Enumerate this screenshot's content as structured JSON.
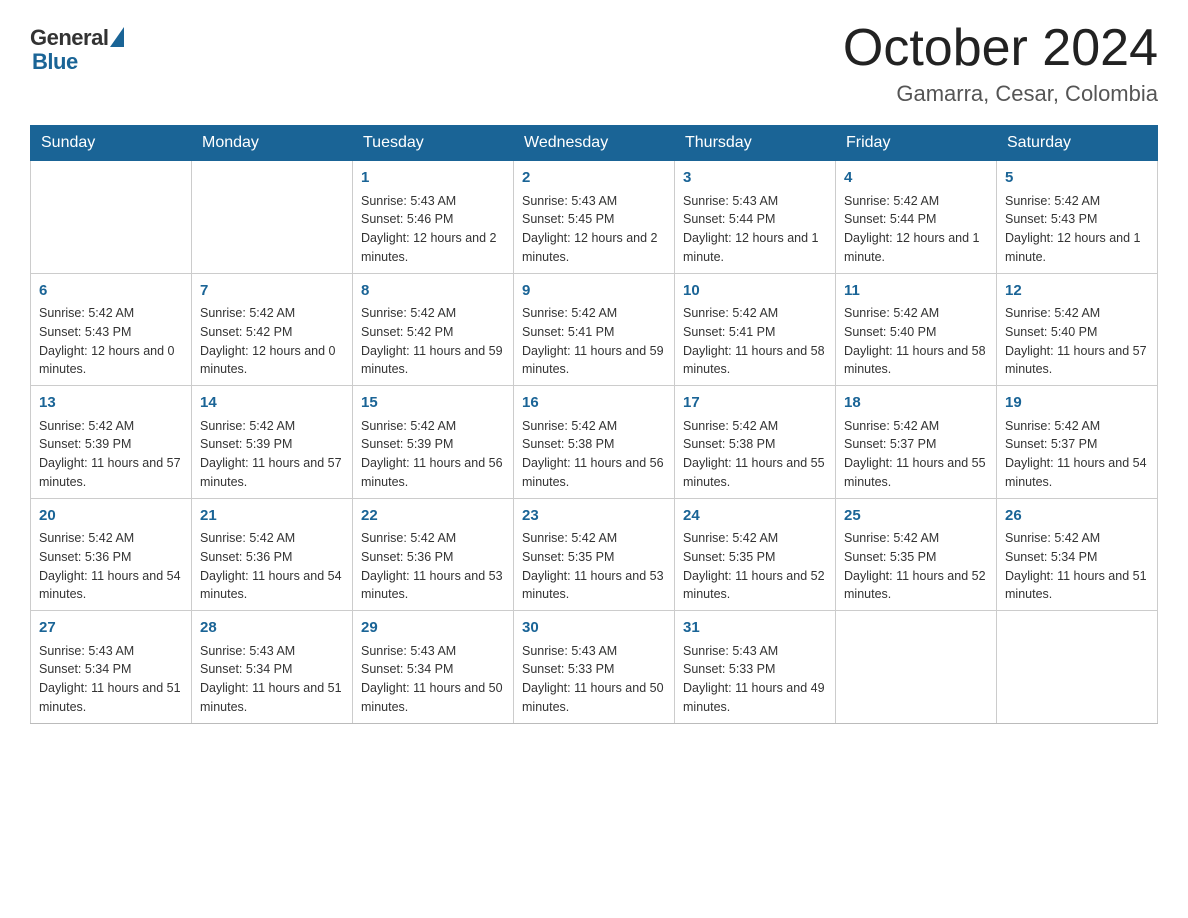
{
  "logo": {
    "general": "General",
    "blue": "Blue"
  },
  "header": {
    "month": "October 2024",
    "location": "Gamarra, Cesar, Colombia"
  },
  "weekdays": [
    "Sunday",
    "Monday",
    "Tuesday",
    "Wednesday",
    "Thursday",
    "Friday",
    "Saturday"
  ],
  "weeks": [
    [
      {
        "day": "",
        "sunrise": "",
        "sunset": "",
        "daylight": ""
      },
      {
        "day": "",
        "sunrise": "",
        "sunset": "",
        "daylight": ""
      },
      {
        "day": "1",
        "sunrise": "Sunrise: 5:43 AM",
        "sunset": "Sunset: 5:46 PM",
        "daylight": "Daylight: 12 hours and 2 minutes."
      },
      {
        "day": "2",
        "sunrise": "Sunrise: 5:43 AM",
        "sunset": "Sunset: 5:45 PM",
        "daylight": "Daylight: 12 hours and 2 minutes."
      },
      {
        "day": "3",
        "sunrise": "Sunrise: 5:43 AM",
        "sunset": "Sunset: 5:44 PM",
        "daylight": "Daylight: 12 hours and 1 minute."
      },
      {
        "day": "4",
        "sunrise": "Sunrise: 5:42 AM",
        "sunset": "Sunset: 5:44 PM",
        "daylight": "Daylight: 12 hours and 1 minute."
      },
      {
        "day": "5",
        "sunrise": "Sunrise: 5:42 AM",
        "sunset": "Sunset: 5:43 PM",
        "daylight": "Daylight: 12 hours and 1 minute."
      }
    ],
    [
      {
        "day": "6",
        "sunrise": "Sunrise: 5:42 AM",
        "sunset": "Sunset: 5:43 PM",
        "daylight": "Daylight: 12 hours and 0 minutes."
      },
      {
        "day": "7",
        "sunrise": "Sunrise: 5:42 AM",
        "sunset": "Sunset: 5:42 PM",
        "daylight": "Daylight: 12 hours and 0 minutes."
      },
      {
        "day": "8",
        "sunrise": "Sunrise: 5:42 AM",
        "sunset": "Sunset: 5:42 PM",
        "daylight": "Daylight: 11 hours and 59 minutes."
      },
      {
        "day": "9",
        "sunrise": "Sunrise: 5:42 AM",
        "sunset": "Sunset: 5:41 PM",
        "daylight": "Daylight: 11 hours and 59 minutes."
      },
      {
        "day": "10",
        "sunrise": "Sunrise: 5:42 AM",
        "sunset": "Sunset: 5:41 PM",
        "daylight": "Daylight: 11 hours and 58 minutes."
      },
      {
        "day": "11",
        "sunrise": "Sunrise: 5:42 AM",
        "sunset": "Sunset: 5:40 PM",
        "daylight": "Daylight: 11 hours and 58 minutes."
      },
      {
        "day": "12",
        "sunrise": "Sunrise: 5:42 AM",
        "sunset": "Sunset: 5:40 PM",
        "daylight": "Daylight: 11 hours and 57 minutes."
      }
    ],
    [
      {
        "day": "13",
        "sunrise": "Sunrise: 5:42 AM",
        "sunset": "Sunset: 5:39 PM",
        "daylight": "Daylight: 11 hours and 57 minutes."
      },
      {
        "day": "14",
        "sunrise": "Sunrise: 5:42 AM",
        "sunset": "Sunset: 5:39 PM",
        "daylight": "Daylight: 11 hours and 57 minutes."
      },
      {
        "day": "15",
        "sunrise": "Sunrise: 5:42 AM",
        "sunset": "Sunset: 5:39 PM",
        "daylight": "Daylight: 11 hours and 56 minutes."
      },
      {
        "day": "16",
        "sunrise": "Sunrise: 5:42 AM",
        "sunset": "Sunset: 5:38 PM",
        "daylight": "Daylight: 11 hours and 56 minutes."
      },
      {
        "day": "17",
        "sunrise": "Sunrise: 5:42 AM",
        "sunset": "Sunset: 5:38 PM",
        "daylight": "Daylight: 11 hours and 55 minutes."
      },
      {
        "day": "18",
        "sunrise": "Sunrise: 5:42 AM",
        "sunset": "Sunset: 5:37 PM",
        "daylight": "Daylight: 11 hours and 55 minutes."
      },
      {
        "day": "19",
        "sunrise": "Sunrise: 5:42 AM",
        "sunset": "Sunset: 5:37 PM",
        "daylight": "Daylight: 11 hours and 54 minutes."
      }
    ],
    [
      {
        "day": "20",
        "sunrise": "Sunrise: 5:42 AM",
        "sunset": "Sunset: 5:36 PM",
        "daylight": "Daylight: 11 hours and 54 minutes."
      },
      {
        "day": "21",
        "sunrise": "Sunrise: 5:42 AM",
        "sunset": "Sunset: 5:36 PM",
        "daylight": "Daylight: 11 hours and 54 minutes."
      },
      {
        "day": "22",
        "sunrise": "Sunrise: 5:42 AM",
        "sunset": "Sunset: 5:36 PM",
        "daylight": "Daylight: 11 hours and 53 minutes."
      },
      {
        "day": "23",
        "sunrise": "Sunrise: 5:42 AM",
        "sunset": "Sunset: 5:35 PM",
        "daylight": "Daylight: 11 hours and 53 minutes."
      },
      {
        "day": "24",
        "sunrise": "Sunrise: 5:42 AM",
        "sunset": "Sunset: 5:35 PM",
        "daylight": "Daylight: 11 hours and 52 minutes."
      },
      {
        "day": "25",
        "sunrise": "Sunrise: 5:42 AM",
        "sunset": "Sunset: 5:35 PM",
        "daylight": "Daylight: 11 hours and 52 minutes."
      },
      {
        "day": "26",
        "sunrise": "Sunrise: 5:42 AM",
        "sunset": "Sunset: 5:34 PM",
        "daylight": "Daylight: 11 hours and 51 minutes."
      }
    ],
    [
      {
        "day": "27",
        "sunrise": "Sunrise: 5:43 AM",
        "sunset": "Sunset: 5:34 PM",
        "daylight": "Daylight: 11 hours and 51 minutes."
      },
      {
        "day": "28",
        "sunrise": "Sunrise: 5:43 AM",
        "sunset": "Sunset: 5:34 PM",
        "daylight": "Daylight: 11 hours and 51 minutes."
      },
      {
        "day": "29",
        "sunrise": "Sunrise: 5:43 AM",
        "sunset": "Sunset: 5:34 PM",
        "daylight": "Daylight: 11 hours and 50 minutes."
      },
      {
        "day": "30",
        "sunrise": "Sunrise: 5:43 AM",
        "sunset": "Sunset: 5:33 PM",
        "daylight": "Daylight: 11 hours and 50 minutes."
      },
      {
        "day": "31",
        "sunrise": "Sunrise: 5:43 AM",
        "sunset": "Sunset: 5:33 PM",
        "daylight": "Daylight: 11 hours and 49 minutes."
      },
      {
        "day": "",
        "sunrise": "",
        "sunset": "",
        "daylight": ""
      },
      {
        "day": "",
        "sunrise": "",
        "sunset": "",
        "daylight": ""
      }
    ]
  ]
}
